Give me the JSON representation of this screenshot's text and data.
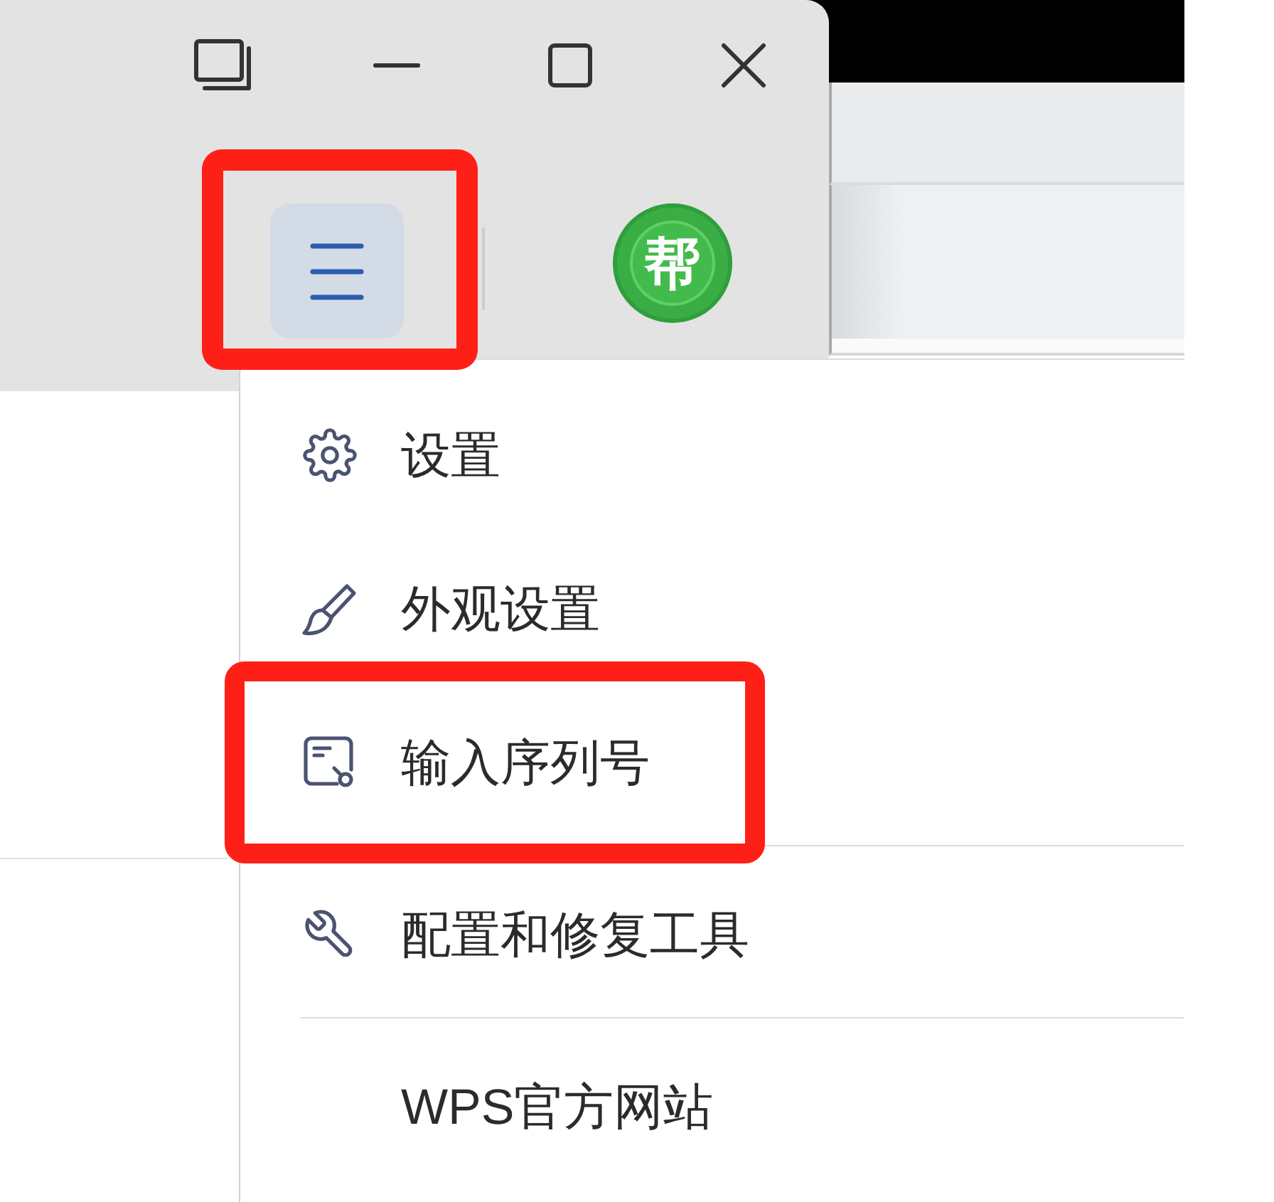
{
  "title_bar": {
    "menu_button": {
      "highlighted": true
    },
    "account_badge": {
      "text": "帮"
    }
  },
  "menu": {
    "groups": [
      {
        "items": [
          {
            "label": "设置",
            "kind": "command",
            "highlighted": false
          },
          {
            "label": "外观设置",
            "kind": "command",
            "highlighted": false
          },
          {
            "label": "输入序列号",
            "kind": "command",
            "highlighted": true
          }
        ]
      },
      {
        "items": [
          {
            "label": "配置和修复工具",
            "kind": "command",
            "highlighted": false
          }
        ]
      },
      {
        "items": [
          {
            "label": "WPS官方网站",
            "kind": "link",
            "highlighted": false
          }
        ]
      }
    ]
  }
}
